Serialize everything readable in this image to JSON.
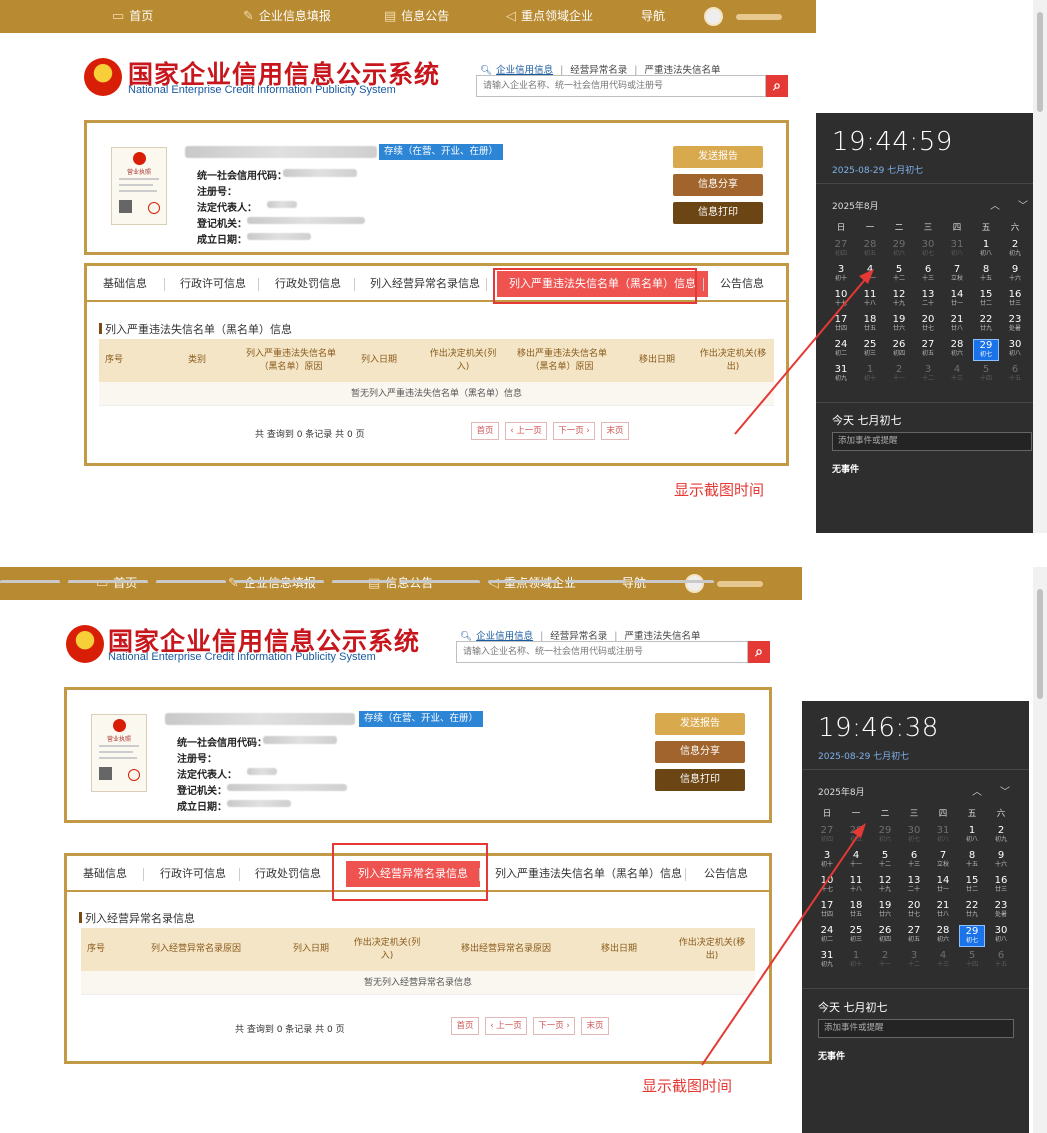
{
  "nav": [
    {
      "label": "首页",
      "icon": "monitor-icon"
    },
    {
      "label": "企业信息填报",
      "icon": "pencil-icon"
    },
    {
      "label": "信息公告",
      "icon": "document-icon"
    },
    {
      "label": "重点领域企业",
      "icon": "speaker-icon"
    },
    {
      "label": "导航",
      "icon": ""
    }
  ],
  "logo": {
    "title": "国家企业信用信息公示系统",
    "subtitle": "National Enterprise Credit Information Publicity System"
  },
  "search": {
    "links": [
      "企业信用信息",
      "经营异常名录",
      "严重违法失信名单"
    ],
    "placeholder": "请输入企业名称、统一社会信用代码或注册号"
  },
  "company": {
    "status": "存续（在营、开业、在册）",
    "fields": [
      "统一社会信用代码：",
      "注册号：",
      "法定代表人：",
      "登记机关：",
      "成立日期："
    ],
    "license_title": "营业执照",
    "buttons": [
      "发送报告",
      "信息分享",
      "信息打印"
    ]
  },
  "tabs": [
    "基础信息",
    "行政许可信息",
    "行政处罚信息",
    "列入经营异常名录信息",
    "列入严重违法失信名单（黑名单）信息",
    "公告信息"
  ],
  "panel1": {
    "title": "列入严重违法失信名单（黑名单）信息",
    "headers": [
      "序号",
      "类别",
      "列入严重违法失信名单（黑名单）原因",
      "列入日期",
      "作出决定机关(列入)",
      "移出严重违法失信名单（黑名单）原因",
      "移出日期",
      "作出决定机关(移出)"
    ],
    "empty": "暂无列入严重违法失信名单（黑名单）信息"
  },
  "panel2": {
    "title": "列入经营异常名录信息",
    "headers": [
      "序号",
      "列入经营异常名录原因",
      "列入日期",
      "作出决定机关(列入)",
      "移出经营异常名录原因",
      "移出日期",
      "作出决定机关(移出)"
    ],
    "empty": "暂无列入经营异常名录信息"
  },
  "pager": {
    "summary": "共 查询到 0 条记录 共 0 页",
    "buttons": [
      "首页",
      "‹ 上一页",
      "下一页 ›",
      "末页"
    ]
  },
  "annotation": "显示截图时间",
  "clock1": {
    "time": "19:44:59"
  },
  "clock2": {
    "time": "19:46:38"
  },
  "calendar": {
    "date_line": "2025-08-29 七月初七",
    "month": "2025年8月",
    "weekdays": [
      "日",
      "一",
      "二",
      "三",
      "四",
      "五",
      "六"
    ],
    "weeks": [
      [
        [
          "27",
          "初四",
          1
        ],
        [
          "28",
          "初五",
          1
        ],
        [
          "29",
          "初六",
          1
        ],
        [
          "30",
          "初七",
          1
        ],
        [
          "31",
          "初八",
          1
        ],
        [
          "1",
          "初八",
          0
        ],
        [
          "2",
          "初九",
          0
        ]
      ],
      [
        [
          "3",
          "初十",
          0
        ],
        [
          "4",
          "十一",
          0
        ],
        [
          "5",
          "十二",
          0
        ],
        [
          "6",
          "十三",
          0
        ],
        [
          "7",
          "立秋",
          0
        ],
        [
          "8",
          "十五",
          0
        ],
        [
          "9",
          "十六",
          0
        ]
      ],
      [
        [
          "10",
          "十七",
          0
        ],
        [
          "11",
          "十八",
          0
        ],
        [
          "12",
          "十九",
          0
        ],
        [
          "13",
          "二十",
          0
        ],
        [
          "14",
          "廿一",
          0
        ],
        [
          "15",
          "廿二",
          0
        ],
        [
          "16",
          "廿三",
          0
        ]
      ],
      [
        [
          "17",
          "廿四",
          0
        ],
        [
          "18",
          "廿五",
          0
        ],
        [
          "19",
          "廿六",
          0
        ],
        [
          "20",
          "廿七",
          0
        ],
        [
          "21",
          "廿八",
          0
        ],
        [
          "22",
          "廿九",
          0
        ],
        [
          "23",
          "处暑",
          0
        ]
      ],
      [
        [
          "24",
          "初二",
          0
        ],
        [
          "25",
          "初三",
          0
        ],
        [
          "26",
          "初四",
          0
        ],
        [
          "27",
          "初五",
          0
        ],
        [
          "28",
          "初六",
          0
        ],
        [
          "29",
          "初七",
          2
        ],
        [
          "30",
          "初八",
          0
        ]
      ],
      [
        [
          "31",
          "初九",
          0
        ],
        [
          "1",
          "初十",
          1
        ],
        [
          "2",
          "十一",
          1
        ],
        [
          "3",
          "十二",
          1
        ],
        [
          "4",
          "十三",
          1
        ],
        [
          "5",
          "十四",
          1
        ],
        [
          "6",
          "十五",
          1
        ]
      ]
    ],
    "today_label": "今天 七月初七",
    "event_placeholder": "添加事件或提醒",
    "no_events": "无事件"
  },
  "colors": {
    "nav": "#b88a31",
    "brand_red": "#c8161d",
    "active_tab": "#ef5350",
    "border_gold": "#c29a45",
    "today_blue": "#1a73e8"
  }
}
